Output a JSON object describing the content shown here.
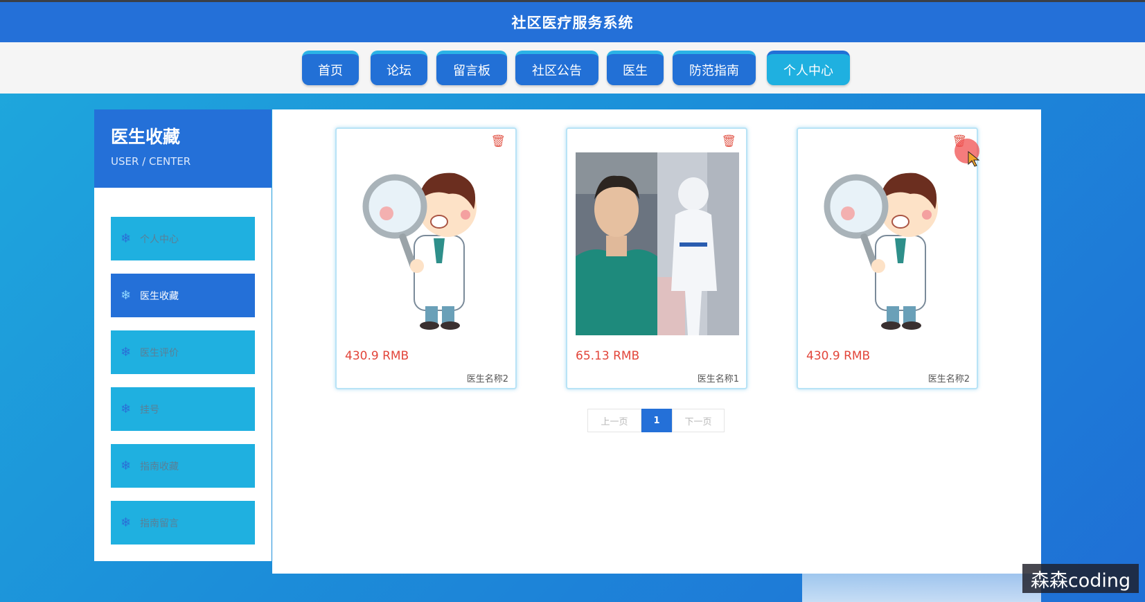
{
  "header": {
    "title": "社区医疗服务系统"
  },
  "nav": {
    "items": [
      {
        "label": "首页"
      },
      {
        "label": "论坛"
      },
      {
        "label": "留言板"
      },
      {
        "label": "社区公告"
      },
      {
        "label": "医生"
      },
      {
        "label": "防范指南"
      },
      {
        "label": "个人中心",
        "active": true
      }
    ]
  },
  "sidebar": {
    "title": "医生收藏",
    "subtitle": "USER / CENTER",
    "items": [
      {
        "label": "个人中心",
        "icon": "snowflake-icon"
      },
      {
        "label": "医生收藏",
        "icon": "snowflake-icon",
        "active": true
      },
      {
        "label": "医生评价",
        "icon": "snowflake-icon"
      },
      {
        "label": "挂号",
        "icon": "snowflake-icon"
      },
      {
        "label": "指南收藏",
        "icon": "snowflake-icon"
      },
      {
        "label": "指南留言",
        "icon": "snowflake-icon"
      }
    ]
  },
  "cards": [
    {
      "price": "430.9 RMB",
      "name": "医生名称2",
      "image": "cartoon-doctor-magnifier"
    },
    {
      "price": "65.13 RMB",
      "name": "医生名称1",
      "image": "doctor-photo"
    },
    {
      "price": "430.9 RMB",
      "name": "医生名称2",
      "image": "cartoon-doctor-magnifier"
    }
  ],
  "pager": {
    "prev": "上一页",
    "current": "1",
    "next": "下一页"
  },
  "watermark": "森森coding",
  "colors": {
    "primary": "#2470d8",
    "accent": "#1fb0e0",
    "price": "#e2453a"
  }
}
